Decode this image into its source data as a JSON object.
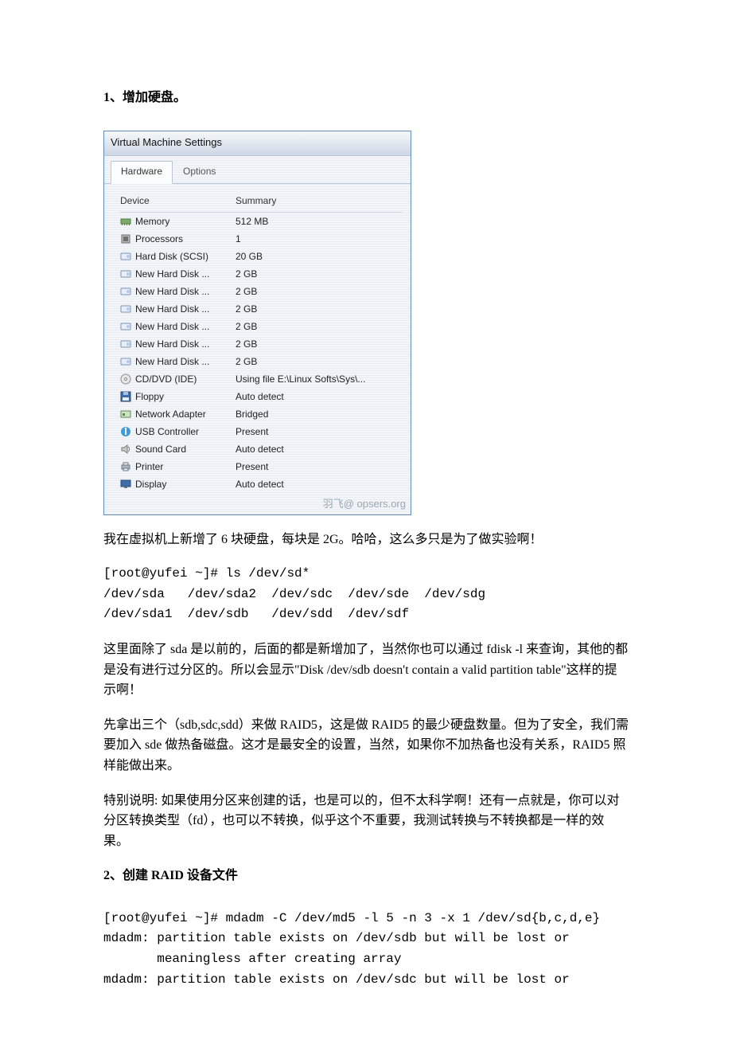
{
  "section1_title": "1、增加硬盘。",
  "vm": {
    "window_title": "Virtual Machine Settings",
    "tabs": {
      "hardware": "Hardware",
      "options": "Options"
    },
    "headers": {
      "device": "Device",
      "summary": "Summary"
    },
    "rows": [
      {
        "icon": "memory",
        "device": "Memory",
        "summary": "512 MB"
      },
      {
        "icon": "cpu",
        "device": "Processors",
        "summary": "1"
      },
      {
        "icon": "hdd",
        "device": "Hard Disk (SCSI)",
        "summary": "20 GB"
      },
      {
        "icon": "hdd",
        "device": "New Hard Disk ...",
        "summary": "2 GB"
      },
      {
        "icon": "hdd",
        "device": "New Hard Disk ...",
        "summary": "2 GB"
      },
      {
        "icon": "hdd",
        "device": "New Hard Disk ...",
        "summary": "2 GB"
      },
      {
        "icon": "hdd",
        "device": "New Hard Disk ...",
        "summary": "2 GB"
      },
      {
        "icon": "hdd",
        "device": "New Hard Disk ...",
        "summary": "2 GB"
      },
      {
        "icon": "hdd",
        "device": "New Hard Disk ...",
        "summary": "2 GB"
      },
      {
        "icon": "cd",
        "device": "CD/DVD (IDE)",
        "summary": "Using file E:\\Linux Softs\\Sys\\..."
      },
      {
        "icon": "floppy",
        "device": "Floppy",
        "summary": "Auto detect"
      },
      {
        "icon": "nic",
        "device": "Network Adapter",
        "summary": "Bridged"
      },
      {
        "icon": "usb",
        "device": "USB Controller",
        "summary": "Present"
      },
      {
        "icon": "sound",
        "device": "Sound Card",
        "summary": "Auto detect"
      },
      {
        "icon": "printer",
        "device": "Printer",
        "summary": "Present"
      },
      {
        "icon": "display",
        "device": "Display",
        "summary": "Auto detect"
      }
    ],
    "watermark": "羽飞@ opsers.org"
  },
  "para1": "我在虚拟机上新增了 6 块硬盘，每块是 2G。哈哈，这么多只是为了做实验啊！",
  "code1": "[root@yufei ~]# ls /dev/sd*\n/dev/sda   /dev/sda2  /dev/sdc  /dev/sde  /dev/sdg\n/dev/sda1  /dev/sdb   /dev/sdd  /dev/sdf",
  "para2": "这里面除了 sda 是以前的，后面的都是新增加了，当然你也可以通过 fdisk -l 来查询，其他的都是没有进行过分区的。所以会显示\"Disk /dev/sdb doesn't contain a valid partition table\"这样的提示啊！",
  "para3": "先拿出三个（sdb,sdc,sdd）来做 RAID5，这是做 RAID5 的最少硬盘数量。但为了安全，我们需要加入 sde 做热备磁盘。这才是最安全的设置，当然，如果你不加热备也没有关系，RAID5 照样能做出来。",
  "para4": "特别说明: 如果使用分区来创建的话，也是可以的，但不太科学啊！还有一点就是，你可以对分区转换类型（fd），也可以不转换，似乎这个不重要，我测试转换与不转换都是一样的效果。",
  "section2_title": "2、创建 RAID 设备文件",
  "code2": "[root@yufei ~]# mdadm -C /dev/md5 -l 5 -n 3 -x 1 /dev/sd{b,c,d,e}\nmdadm: partition table exists on /dev/sdb but will be lost or\n       meaningless after creating array\nmdadm: partition table exists on /dev/sdc but will be lost or"
}
